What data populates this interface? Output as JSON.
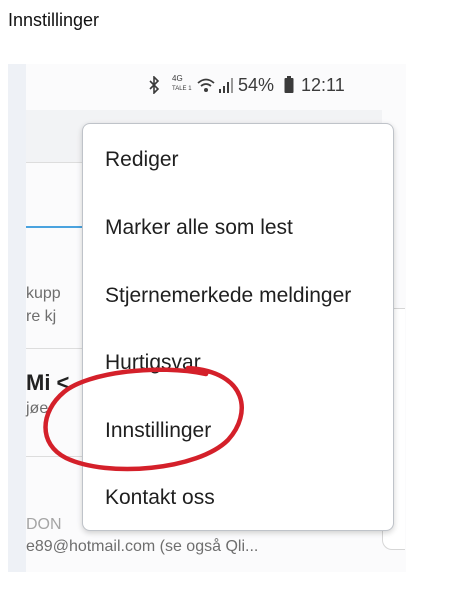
{
  "page_heading": "Innstillinger",
  "status_bar": {
    "network_label": "4G",
    "sub_label": "TALE 1",
    "battery_percent": "54%",
    "time": "12:11",
    "icons": [
      "bluetooth-icon",
      "wifi-icon",
      "signal-icon",
      "battery-icon"
    ]
  },
  "background": {
    "snippet_line1": "kupp",
    "snippet_line2": "re kj",
    "sender_partial": "Mi <",
    "preview_partial": "jøe",
    "footer_partial": "DON",
    "footer_email": "e89@hotmail.com (se også Qli..."
  },
  "menu": {
    "items": [
      {
        "label": "Rediger"
      },
      {
        "label": "Marker alle som lest"
      },
      {
        "label": "Stjernemerkede meldinger"
      },
      {
        "label": "Hurtigsvar"
      },
      {
        "label": "Innstillinger"
      },
      {
        "label": "Kontakt oss"
      }
    ]
  },
  "colors": {
    "annotation": "#d4202a",
    "accent_line": "#4aa3df",
    "menu_border": "#bfc3c9"
  }
}
